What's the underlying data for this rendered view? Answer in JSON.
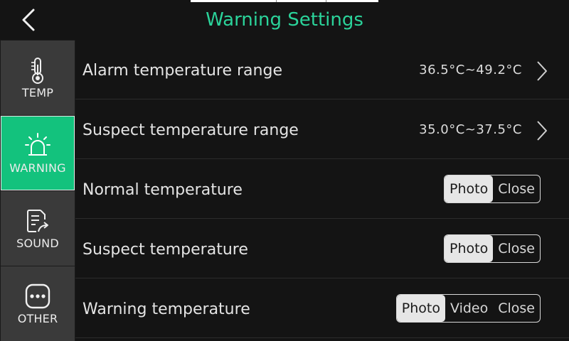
{
  "header": {
    "title": "Warning Settings"
  },
  "sidebar": {
    "items": [
      {
        "label": "TEMP",
        "icon": "thermometer-icon",
        "active": false
      },
      {
        "label": "WARNING",
        "icon": "alarm-light-icon",
        "active": true
      },
      {
        "label": "SOUND",
        "icon": "document-share-icon",
        "active": false
      },
      {
        "label": "OTHER",
        "icon": "more-dots-icon",
        "active": false
      }
    ]
  },
  "rows": [
    {
      "label": "Alarm temperature range",
      "value": "36.5°C~49.2°C"
    },
    {
      "label": "Suspect temperature range",
      "value": "35.0°C~37.5°C"
    },
    {
      "label": "Normal temperature",
      "options": [
        "Photo",
        "Close"
      ],
      "selected": "Photo"
    },
    {
      "label": "Suspect temperature",
      "options": [
        "Photo",
        "Close"
      ],
      "selected": "Photo"
    },
    {
      "label": "Warning temperature",
      "options": [
        "Photo",
        "Video",
        "Close"
      ],
      "selected": "Photo"
    }
  ],
  "colors": {
    "accent": "#2bd39a",
    "active_nav": "#13c27d",
    "nav_bg": "#3a3a3a",
    "background": "#141414"
  }
}
